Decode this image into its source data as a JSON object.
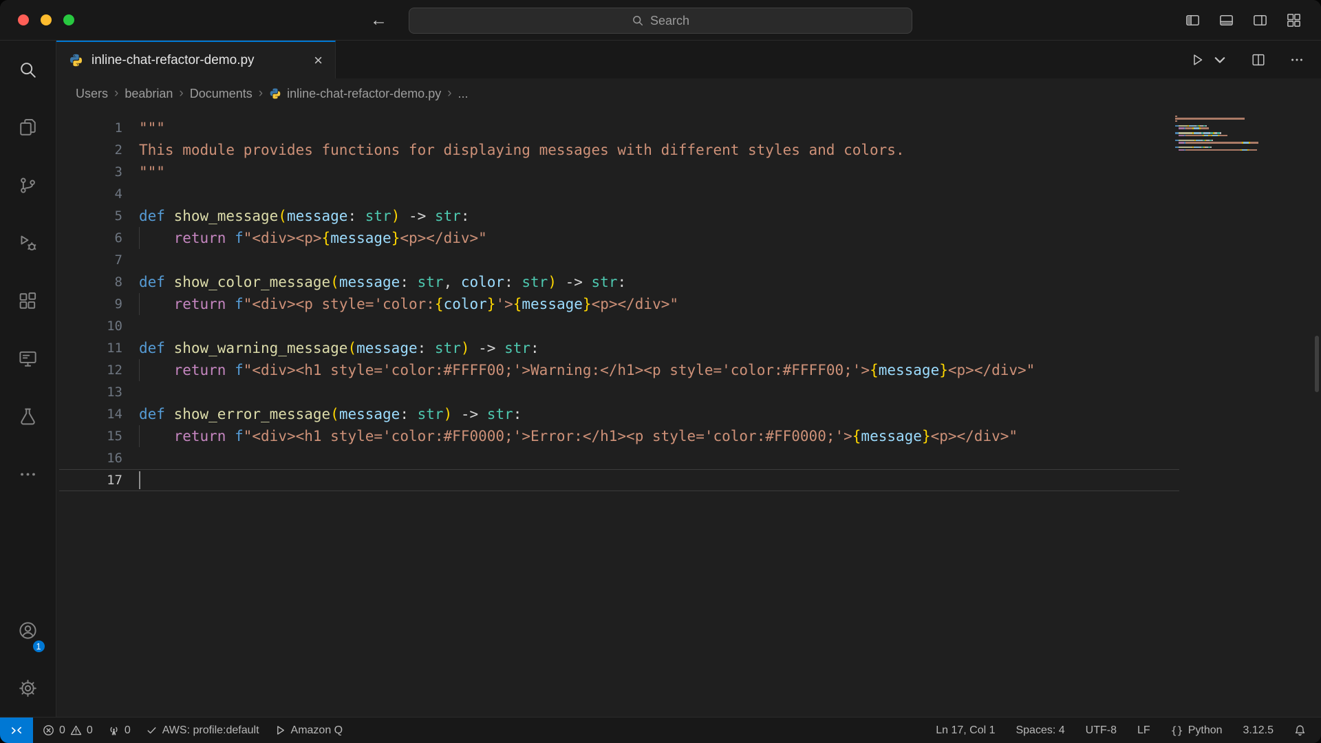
{
  "titlebar": {
    "search_placeholder": "Search",
    "back_arrow": "←",
    "forward_arrow": "→"
  },
  "tab": {
    "label": "inline-chat-refactor-demo.py",
    "close_glyph": "×"
  },
  "breadcrumb": {
    "separator": "›",
    "items": [
      "Users",
      "beabrian",
      "Documents",
      "inline-chat-refactor-demo.py",
      "..."
    ]
  },
  "activity_bar": {
    "icons": [
      "search",
      "explorer",
      "source-control",
      "run-and-debug",
      "extensions",
      "remote-explorer",
      "testing",
      "more-actions",
      "accounts",
      "settings"
    ],
    "accounts_badge": "1"
  },
  "editor": {
    "cursor_line": 17,
    "lines": [
      {
        "n": 1,
        "t": [
          [
            "\"\"\"",
            "str"
          ]
        ]
      },
      {
        "n": 2,
        "t": [
          [
            "This module provides functions for displaying messages with different styles and colors.",
            "str"
          ]
        ]
      },
      {
        "n": 3,
        "t": [
          [
            "\"\"\"",
            "str"
          ]
        ]
      },
      {
        "n": 4,
        "t": []
      },
      {
        "n": 5,
        "t": [
          [
            "def ",
            "kw"
          ],
          [
            "show_message",
            "fn"
          ],
          [
            "(",
            "br"
          ],
          [
            "message",
            "var"
          ],
          [
            ": ",
            "pn"
          ],
          [
            "str",
            "typ"
          ],
          [
            ")",
            "br"
          ],
          [
            " -> ",
            "pn"
          ],
          [
            "str",
            "typ"
          ],
          [
            ":",
            "pn"
          ]
        ]
      },
      {
        "n": 6,
        "t": [
          [
            "    ",
            "ws"
          ],
          [
            "return ",
            "ctl"
          ],
          [
            "f",
            "kw"
          ],
          [
            "\"<div><p>",
            "str"
          ],
          [
            "{",
            "br"
          ],
          [
            "message",
            "var"
          ],
          [
            "}",
            "br"
          ],
          [
            "<p></div>\"",
            "str"
          ]
        ]
      },
      {
        "n": 7,
        "t": []
      },
      {
        "n": 8,
        "t": [
          [
            "def ",
            "kw"
          ],
          [
            "show_color_message",
            "fn"
          ],
          [
            "(",
            "br"
          ],
          [
            "message",
            "var"
          ],
          [
            ": ",
            "pn"
          ],
          [
            "str",
            "typ"
          ],
          [
            ", ",
            "pn"
          ],
          [
            "color",
            "var"
          ],
          [
            ": ",
            "pn"
          ],
          [
            "str",
            "typ"
          ],
          [
            ")",
            "br"
          ],
          [
            " -> ",
            "pn"
          ],
          [
            "str",
            "typ"
          ],
          [
            ":",
            "pn"
          ]
        ]
      },
      {
        "n": 9,
        "t": [
          [
            "    ",
            "ws"
          ],
          [
            "return ",
            "ctl"
          ],
          [
            "f",
            "kw"
          ],
          [
            "\"<div><p style='color:",
            "str"
          ],
          [
            "{",
            "br"
          ],
          [
            "color",
            "var"
          ],
          [
            "}",
            "br"
          ],
          [
            "'>",
            "str"
          ],
          [
            "{",
            "br"
          ],
          [
            "message",
            "var"
          ],
          [
            "}",
            "br"
          ],
          [
            "<p></div>\"",
            "str"
          ]
        ]
      },
      {
        "n": 10,
        "t": []
      },
      {
        "n": 11,
        "t": [
          [
            "def ",
            "kw"
          ],
          [
            "show_warning_message",
            "fn"
          ],
          [
            "(",
            "br"
          ],
          [
            "message",
            "var"
          ],
          [
            ": ",
            "pn"
          ],
          [
            "str",
            "typ"
          ],
          [
            ")",
            "br"
          ],
          [
            " -> ",
            "pn"
          ],
          [
            "str",
            "typ"
          ],
          [
            ":",
            "pn"
          ]
        ]
      },
      {
        "n": 12,
        "t": [
          [
            "    ",
            "ws"
          ],
          [
            "return ",
            "ctl"
          ],
          [
            "f",
            "kw"
          ],
          [
            "\"<div><h1 style='color:#FFFF00;'>Warning:</h1><p style='color:#FFFF00;'>",
            "str"
          ],
          [
            "{",
            "br"
          ],
          [
            "message",
            "var"
          ],
          [
            "}",
            "br"
          ],
          [
            "<p></div>\"",
            "str"
          ]
        ]
      },
      {
        "n": 13,
        "t": []
      },
      {
        "n": 14,
        "t": [
          [
            "def ",
            "kw"
          ],
          [
            "show_error_message",
            "fn"
          ],
          [
            "(",
            "br"
          ],
          [
            "message",
            "var"
          ],
          [
            ": ",
            "pn"
          ],
          [
            "str",
            "typ"
          ],
          [
            ")",
            "br"
          ],
          [
            " -> ",
            "pn"
          ],
          [
            "str",
            "typ"
          ],
          [
            ":",
            "pn"
          ]
        ]
      },
      {
        "n": 15,
        "t": [
          [
            "    ",
            "ws"
          ],
          [
            "return ",
            "ctl"
          ],
          [
            "f",
            "kw"
          ],
          [
            "\"<div><h1 style='color:#FF0000;'>Error:</h1><p style='color:#FF0000;'>",
            "str"
          ],
          [
            "{",
            "br"
          ],
          [
            "message",
            "var"
          ],
          [
            "}",
            "br"
          ],
          [
            "<p></div>\"",
            "str"
          ]
        ]
      },
      {
        "n": 16,
        "t": []
      },
      {
        "n": 17,
        "t": []
      }
    ]
  },
  "statusbar": {
    "errors": "0",
    "warnings": "0",
    "ports": "0",
    "aws_profile": "AWS: profile:default",
    "amazon_q": "Amazon Q",
    "cursor_position": "Ln 17, Col 1",
    "indentation": "Spaces: 4",
    "encoding": "UTF-8",
    "eol": "LF",
    "braces_glyph": "{}",
    "language": "Python",
    "interpreter_version": "3.12.5"
  },
  "colors": {
    "accent_blue": "#0078d4",
    "traffic_red": "#ff5f57",
    "traffic_yellow": "#febc2e",
    "traffic_green": "#28c840"
  }
}
